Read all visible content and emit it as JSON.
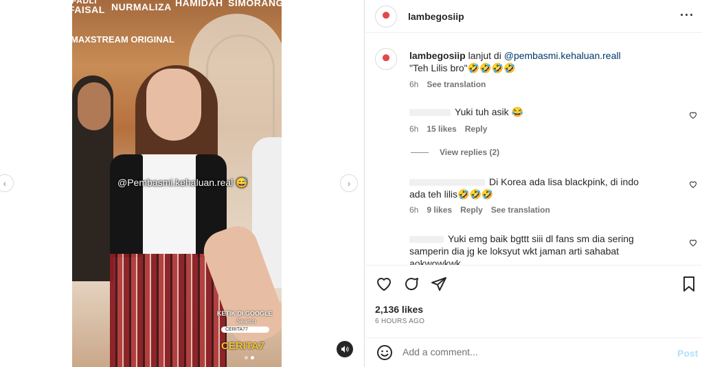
{
  "media": {
    "banner_names": [
      "FADLI",
      "FAISAL",
      "NURMALIZA",
      "HAMIDAH",
      "SIMORANG"
    ],
    "brand_text": "MAXSTREAM ORIGINAL",
    "overlay_caption": "@Pembasmi.kehaluan.real 😅",
    "sticker": {
      "line1": "KETIK DI GOOGLE",
      "line2": "Search",
      "search_value": "CERITA77",
      "logo": "CERITA7"
    },
    "carousel_dots": 2,
    "active_dot": 1,
    "nav_prev_icon": "chevron-left-icon",
    "nav_next_icon": "chevron-right-icon"
  },
  "header": {
    "username": "lambegosiip",
    "more_icon": "more-options-icon"
  },
  "caption": {
    "username": "lambegosiip",
    "text_prefix": "lanjut di ",
    "mention": "@pembasmi.kehaluan.reall",
    "quote": "\"Teh Lilis bro\"🤣🤣🤣🤣",
    "time": "6h",
    "translate": "See translation"
  },
  "comments": [
    {
      "text": "Yuki tuh asik 😂",
      "time": "6h",
      "likes": "15 likes",
      "reply": "Reply"
    },
    {
      "text": "Di Korea ada lisa blackpink, di indo ada teh lilis🤣🤣🤣",
      "time": "6h",
      "likes": "9 likes",
      "reply": "Reply",
      "translate": "See translation"
    },
    {
      "text": "Yuki emg baik bgttt siii dl fans sm dia sering samperin dia jg ke loksyut wkt jaman arti sahabat aokwowkwk"
    }
  ],
  "view_replies": "View replies (2)",
  "actions": {
    "likes": "2,136 likes",
    "time": "6 HOURS AGO"
  },
  "add_comment": {
    "placeholder": "Add a comment...",
    "post_label": "Post"
  }
}
